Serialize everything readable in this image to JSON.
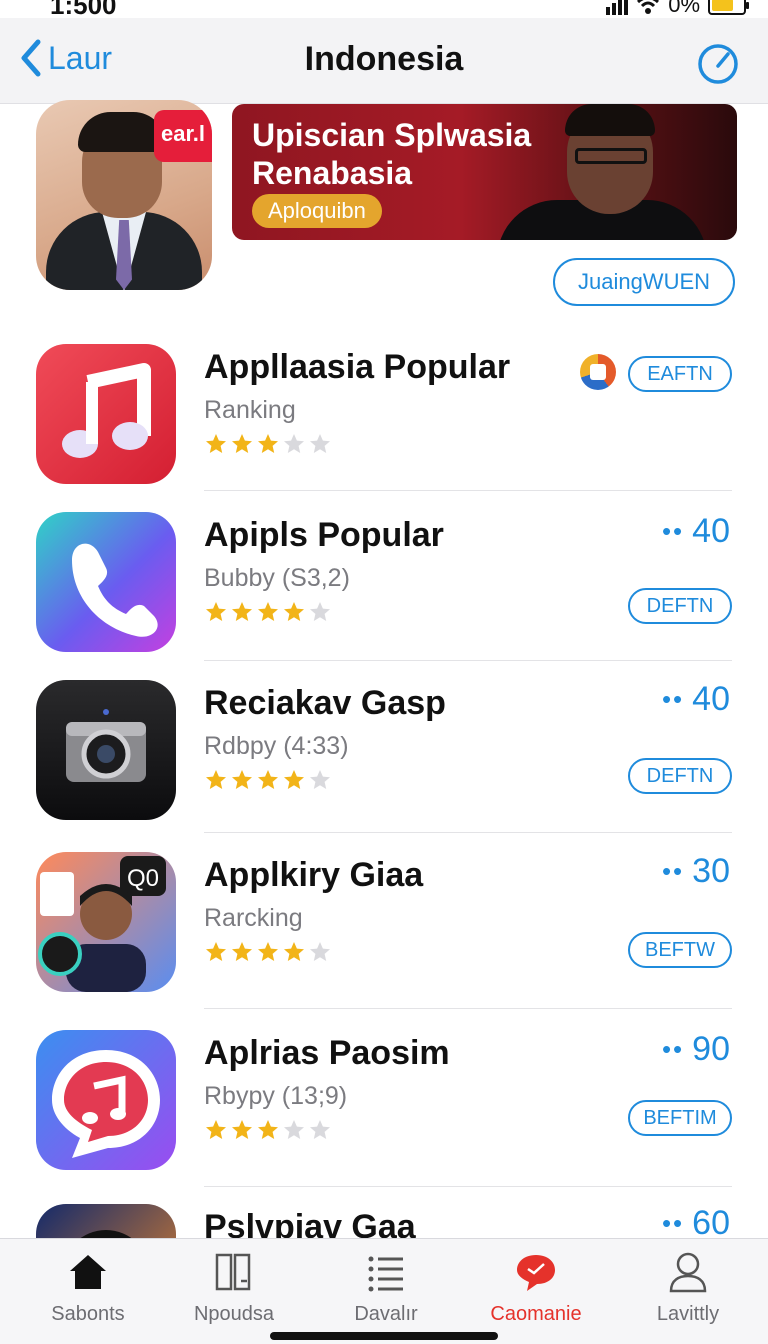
{
  "status_bar": {
    "time": "1:500",
    "battery_percent": "0%",
    "battery_level": 0.7,
    "battery_color": "#f4c21c"
  },
  "nav": {
    "back_label": "Laur",
    "title": "Indonesia",
    "action_icon": "gauge-icon"
  },
  "featured": {
    "icon_badge": "ear.l",
    "banner_title_line1": "Upiscian Splwasia",
    "banner_title_line2": "Renabasia",
    "banner_tag": "Aploquibn",
    "action_label": "JuaingWUEN"
  },
  "apps": [
    {
      "name": "Appllaasia Popular",
      "subtitle": "Ranking",
      "rating": 3,
      "price": "",
      "button": "EAFTN"
    },
    {
      "name": "Apipls Popular",
      "subtitle": "Bubby (S3,2)",
      "rating": 4,
      "price": "40",
      "button": "DEFTN"
    },
    {
      "name": "Reciakav Gasp",
      "subtitle": "Rdbpy (4:33)",
      "rating": 4,
      "price": "40",
      "button": "DEFTN"
    },
    {
      "name": "Applkiry Giaa",
      "subtitle": "Rarcking",
      "rating": 4,
      "price": "30",
      "button": "BEFTW"
    },
    {
      "name": "Aplrias Paosim",
      "subtitle": "Rbypy (13;9)",
      "rating": 3,
      "price": "90",
      "button": "BEFTIM"
    },
    {
      "name": "Pslvpiav Gaa",
      "subtitle": "",
      "rating": 0,
      "price": "60",
      "button": ""
    }
  ],
  "price_prefix": "••",
  "tabs": [
    {
      "label": "Sabonts",
      "icon": "home-icon",
      "active": false
    },
    {
      "label": "Npoudsa",
      "icon": "books-icon",
      "active": false
    },
    {
      "label": "Davalır",
      "icon": "list-icon",
      "active": false
    },
    {
      "label": "Caomanie",
      "icon": "chat-bubble-icon",
      "active": true
    },
    {
      "label": "Lavittly",
      "icon": "person-icon",
      "active": false
    }
  ],
  "colors": {
    "accent": "#1f8bdc",
    "active_tab": "#e5322b",
    "star": "#f2b418",
    "star_empty": "#d9d9dd"
  }
}
